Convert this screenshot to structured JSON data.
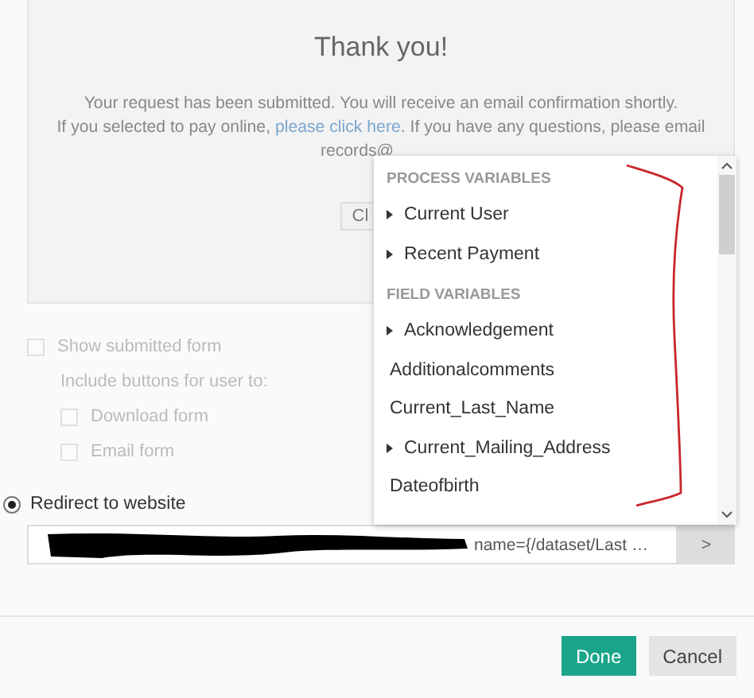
{
  "preview": {
    "title": "Thank you!",
    "line_1": "Your request has been submitted. You will receive an email confirmation shortly.",
    "line_2": {
      "before": "If you selected to pay online, ",
      "link": "please click here",
      "after": ". If you have any questions, please email"
    },
    "line_3": "records@",
    "button": "Cl"
  },
  "show_submitted_form": {
    "label": "Show submitted form",
    "checked": false,
    "disabled": true
  },
  "include_label": "Include buttons for user to:",
  "include_options": [
    {
      "label": "Download form",
      "checked": false,
      "disabled": true
    },
    {
      "label": "Email form",
      "checked": false,
      "disabled": true
    }
  ],
  "redirect": {
    "label": "Redirect to website",
    "selected": true
  },
  "url_field": {
    "value": "name={/dataset/Last …",
    "button": ">"
  },
  "variables_menu": {
    "groups": [
      {
        "heading": "PROCESS VARIABLES",
        "items": [
          {
            "label": "Current User",
            "expandable": true
          },
          {
            "label": "Recent Payment",
            "expandable": true
          }
        ]
      },
      {
        "heading": "FIELD VARIABLES",
        "items": [
          {
            "label": "Acknowledgement",
            "expandable": true
          },
          {
            "label": "Additionalcomments",
            "expandable": false
          },
          {
            "label": "Current_Last_Name",
            "expandable": false
          },
          {
            "label": "Current_Mailing_Address",
            "expandable": true
          },
          {
            "label": "Dateofbirth",
            "expandable": false
          }
        ]
      }
    ]
  },
  "buttons": [
    {
      "label": "Done",
      "kind": "primary"
    },
    {
      "label": "Cancel",
      "kind": "secondary"
    }
  ]
}
